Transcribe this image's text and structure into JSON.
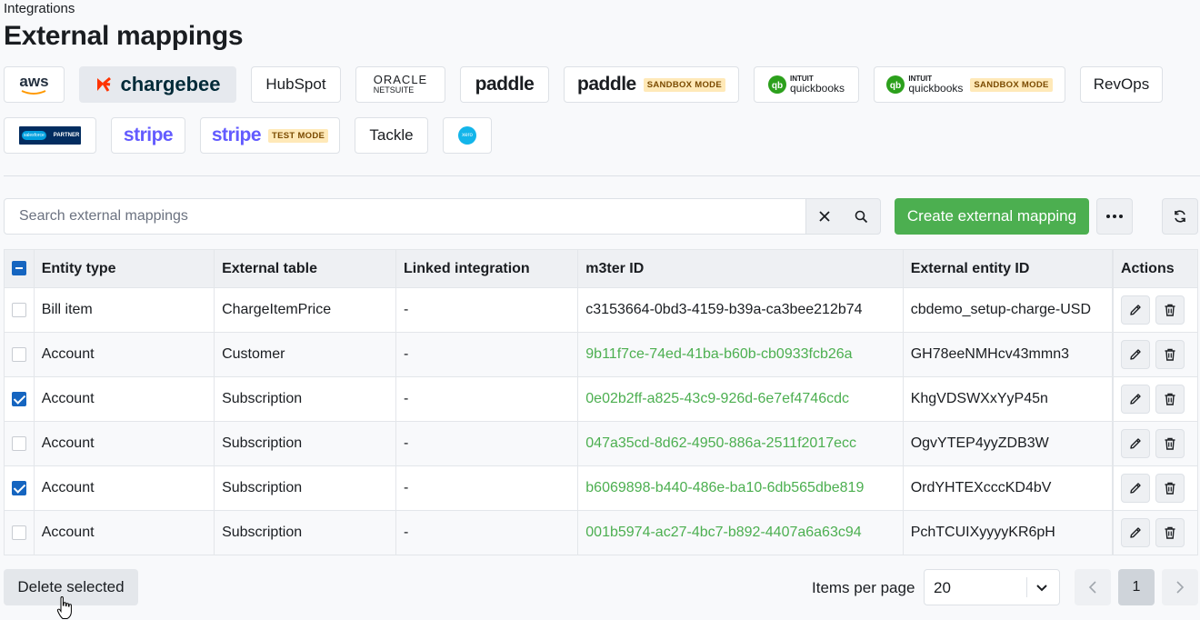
{
  "header": {
    "breadcrumb": "Integrations",
    "title": "External mappings"
  },
  "integrations": {
    "aws": "aws",
    "chargebee": "chargebee",
    "hubspot": "HubSpot",
    "oracle": "ORACLE",
    "netsuite": "NETSUITE",
    "paddle": "paddle",
    "paddle_sandbox": "paddle",
    "sandbox_badge": "SANDBOX MODE",
    "intuit": "INTUIT",
    "quickbooks": "quickbooks",
    "revops": "RevOps",
    "salesforce": "salesforce",
    "partner": "PARTNER",
    "stripe": "stripe",
    "test_badge": "TEST MODE",
    "tackle": "Tackle",
    "xero": "xero"
  },
  "search": {
    "placeholder": "Search external mappings"
  },
  "toolbar": {
    "create_label": "Create external mapping"
  },
  "table": {
    "headers": [
      "Entity type",
      "External table",
      "Linked integration",
      "m3ter ID",
      "External entity ID",
      "Actions"
    ],
    "rows": [
      {
        "entity_type": "Bill item",
        "external_table": "ChargeItemPrice",
        "linked": "-",
        "m3ter_id": "c3153664-0bd3-4159-b39a-ca3bee212b74",
        "external_id": "cbdemo_setup-charge-USD",
        "checked": false,
        "link": false
      },
      {
        "entity_type": "Account",
        "external_table": "Customer",
        "linked": "-",
        "m3ter_id": "9b11f7ce-74ed-41ba-b60b-cb0933fcb26a",
        "external_id": "GH78eeNMHcv43mmn3",
        "checked": false,
        "link": true
      },
      {
        "entity_type": "Account",
        "external_table": "Subscription",
        "linked": "-",
        "m3ter_id": "0e02b2ff-a825-43c9-926d-6e7ef4746cdc",
        "external_id": "KhgVDSWXxYyP45n",
        "checked": true,
        "link": true
      },
      {
        "entity_type": "Account",
        "external_table": "Subscription",
        "linked": "-",
        "m3ter_id": "047a35cd-8d62-4950-886a-2511f2017ecc",
        "external_id": "OgvYTEP4yyZDB3W",
        "checked": false,
        "link": true
      },
      {
        "entity_type": "Account",
        "external_table": "Subscription",
        "linked": "-",
        "m3ter_id": "b6069898-b440-486e-ba10-6db565dbe819",
        "external_id": "OrdYHTEXcccKD4bV",
        "checked": true,
        "link": true
      },
      {
        "entity_type": "Account",
        "external_table": "Subscription",
        "linked": "-",
        "m3ter_id": "001b5974-ac27-4bc7-b892-4407a6a63c94",
        "external_id": "PchTCUIXyyyyKR6pH",
        "checked": false,
        "link": true
      }
    ]
  },
  "footer": {
    "delete_label": "Delete selected",
    "items_per_page_label": "Items per page",
    "items_per_page_value": "20",
    "current_page": "1"
  },
  "colors": {
    "accent": "#4caf50",
    "checkbox": "#1565c0",
    "badge": "#ffe9b8"
  }
}
